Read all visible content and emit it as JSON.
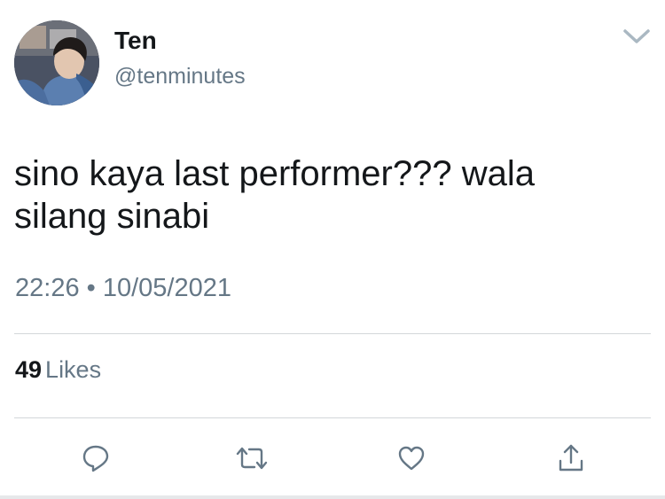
{
  "author": {
    "display_name": "Ten",
    "handle": "@tenminutes"
  },
  "tweet": {
    "text_lines": [
      "sino kaya last performer??? wala",
      "silang sinabi"
    ],
    "timestamp": "22:26 • 10/05/2021"
  },
  "stats": {
    "likes_count": "49",
    "likes_label": "Likes"
  },
  "icons": {
    "menu": "chevron-down-icon",
    "reply": "reply-icon",
    "retweet": "retweet-icon",
    "like": "heart-icon",
    "share": "share-icon"
  },
  "colors": {
    "text_primary": "#14171a",
    "text_secondary": "#657786",
    "divider": "#d3d7da",
    "icon": "#657786"
  }
}
